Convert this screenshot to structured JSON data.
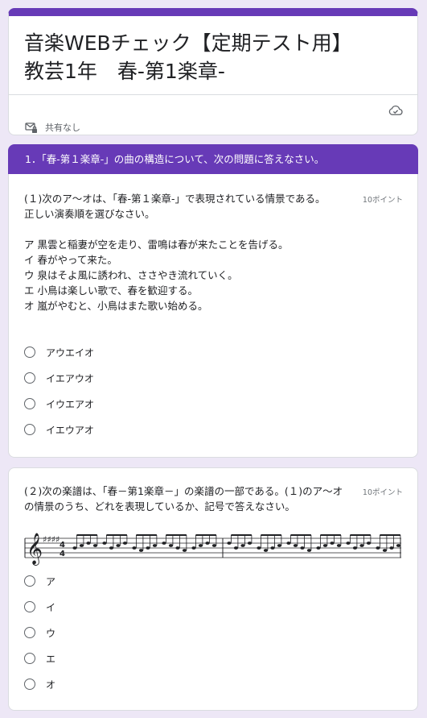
{
  "form": {
    "title_line1": "音楽WEBチェック【定期テスト用】",
    "title_line2": "教芸1年　春-第1楽章-",
    "share_label": "共有なし",
    "accent_color": "#673ab7",
    "background_color": "#ede7f6",
    "icons": {
      "cloud": "cloud-check-icon",
      "share": "mail-lock-icon"
    }
  },
  "section": {
    "header": "1．「春-第１楽章-」の曲の構造について、次の問題に答えなさい。"
  },
  "q1": {
    "prompt_line1": "(１)次のア〜オは、「春-第１楽章-」で表現されている情景である。",
    "prompt_line2": "正しい演奏順を選びなさい。",
    "points": "10ポイント",
    "scenes": [
      "ア 黒雲と稲妻が空を走り、雷鳴は春が来たことを告げる。",
      "イ 春がやって来た。",
      "ウ 泉はそよ風に誘われ、ささやき流れていく。",
      "エ 小鳥は楽しい歌で、春を歓迎する。",
      "オ 嵐がやむと、小鳥はまた歌い始める。"
    ],
    "options": [
      "アウエイオ",
      "イエアウオ",
      "イウエアオ",
      "イエウアオ"
    ]
  },
  "q2": {
    "prompt_line1": "(２)次の楽譜は、「春－第1楽章－」の楽譜の一部である。(１)のア〜オ",
    "prompt_line2": "の情景のうち、どれを表現しているか、記号で答えなさい。",
    "points": "10ポイント",
    "score_time_signature_top": "4",
    "score_time_signature_bottom": "4",
    "options": [
      "ア",
      "イ",
      "ウ",
      "エ",
      "オ"
    ]
  }
}
